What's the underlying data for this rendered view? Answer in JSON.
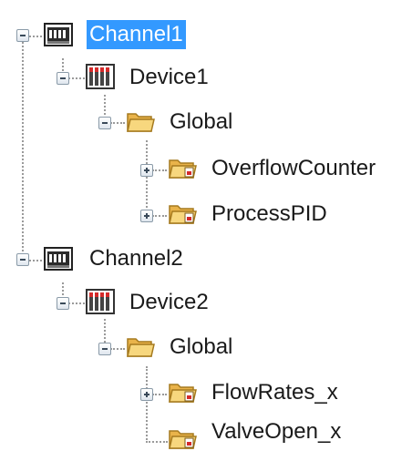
{
  "tree": {
    "channel1": {
      "label": "Channel1",
      "selected": true,
      "device": {
        "label": "Device1",
        "group": {
          "label": "Global",
          "items": [
            "OverflowCounter",
            "ProcessPID"
          ]
        }
      }
    },
    "channel2": {
      "label": "Channel2",
      "selected": false,
      "device": {
        "label": "Device2",
        "group": {
          "label": "Global",
          "items": [
            "FlowRates_x",
            "ValveOpen_x"
          ]
        }
      }
    }
  },
  "colors": {
    "selection_background": "#3399ff",
    "selection_text": "#ffffff",
    "connector": "#9a9a9a",
    "folder": "#f0c35a"
  },
  "icons": {
    "channel": "channel-network-icon",
    "device": "device-rack-icon",
    "group": "folder-icon",
    "tag_group": "folder-icon"
  }
}
